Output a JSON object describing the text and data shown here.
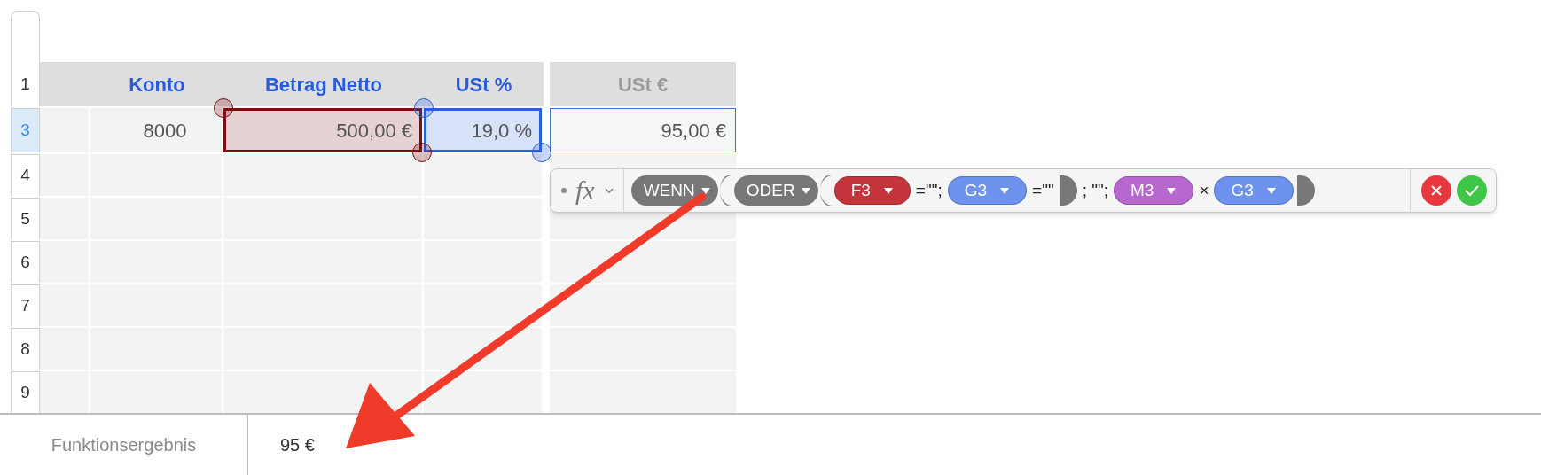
{
  "table": {
    "header_row": {
      "label": "1",
      "selected": false
    },
    "columns": [
      {
        "label": "Konto",
        "color": "#2a5bd7"
      },
      {
        "label": "Betrag Netto",
        "color": "#2a5bd7"
      },
      {
        "label": "USt %",
        "color": "#2a5bd7"
      },
      {
        "label": "USt €",
        "color": "#9b9b9b"
      }
    ],
    "rows": [
      {
        "label": "3",
        "selected": true,
        "cells": [
          {
            "kind": "plain",
            "text": "8000"
          },
          {
            "kind": "reference",
            "text": "500,00 €",
            "color": "#7b0f14"
          },
          {
            "kind": "reference",
            "text": "19,0 %",
            "color": "#2c5fd4"
          },
          {
            "kind": "editing",
            "text": "95,00 €"
          }
        ]
      },
      {
        "label": "4",
        "selected": false
      },
      {
        "label": "5",
        "selected": false
      },
      {
        "label": "6",
        "selected": false
      },
      {
        "label": "7",
        "selected": false
      },
      {
        "label": "8",
        "selected": false
      },
      {
        "label": "9",
        "selected": false
      }
    ]
  },
  "formula_bar": {
    "fx": "fx",
    "tokens": [
      {
        "kind": "function",
        "text": "WENN"
      },
      {
        "kind": "open"
      },
      {
        "kind": "function",
        "text": "ODER"
      },
      {
        "kind": "open"
      },
      {
        "kind": "reference",
        "text": "F3",
        "color": "#c4353b"
      },
      {
        "kind": "text",
        "text": "=\"\";"
      },
      {
        "kind": "reference",
        "text": "G3",
        "color": "#6e93ee"
      },
      {
        "kind": "text",
        "text": "=\"\""
      },
      {
        "kind": "close"
      },
      {
        "kind": "text",
        "text": "; \"\";"
      },
      {
        "kind": "reference",
        "text": "M3",
        "color": "#b668cf"
      },
      {
        "kind": "text",
        "text": "×"
      },
      {
        "kind": "reference",
        "text": "G3",
        "color": "#6e93ee"
      },
      {
        "kind": "close"
      }
    ]
  },
  "result_bar": {
    "label": "Funktionsergebnis",
    "value": "95 €"
  }
}
